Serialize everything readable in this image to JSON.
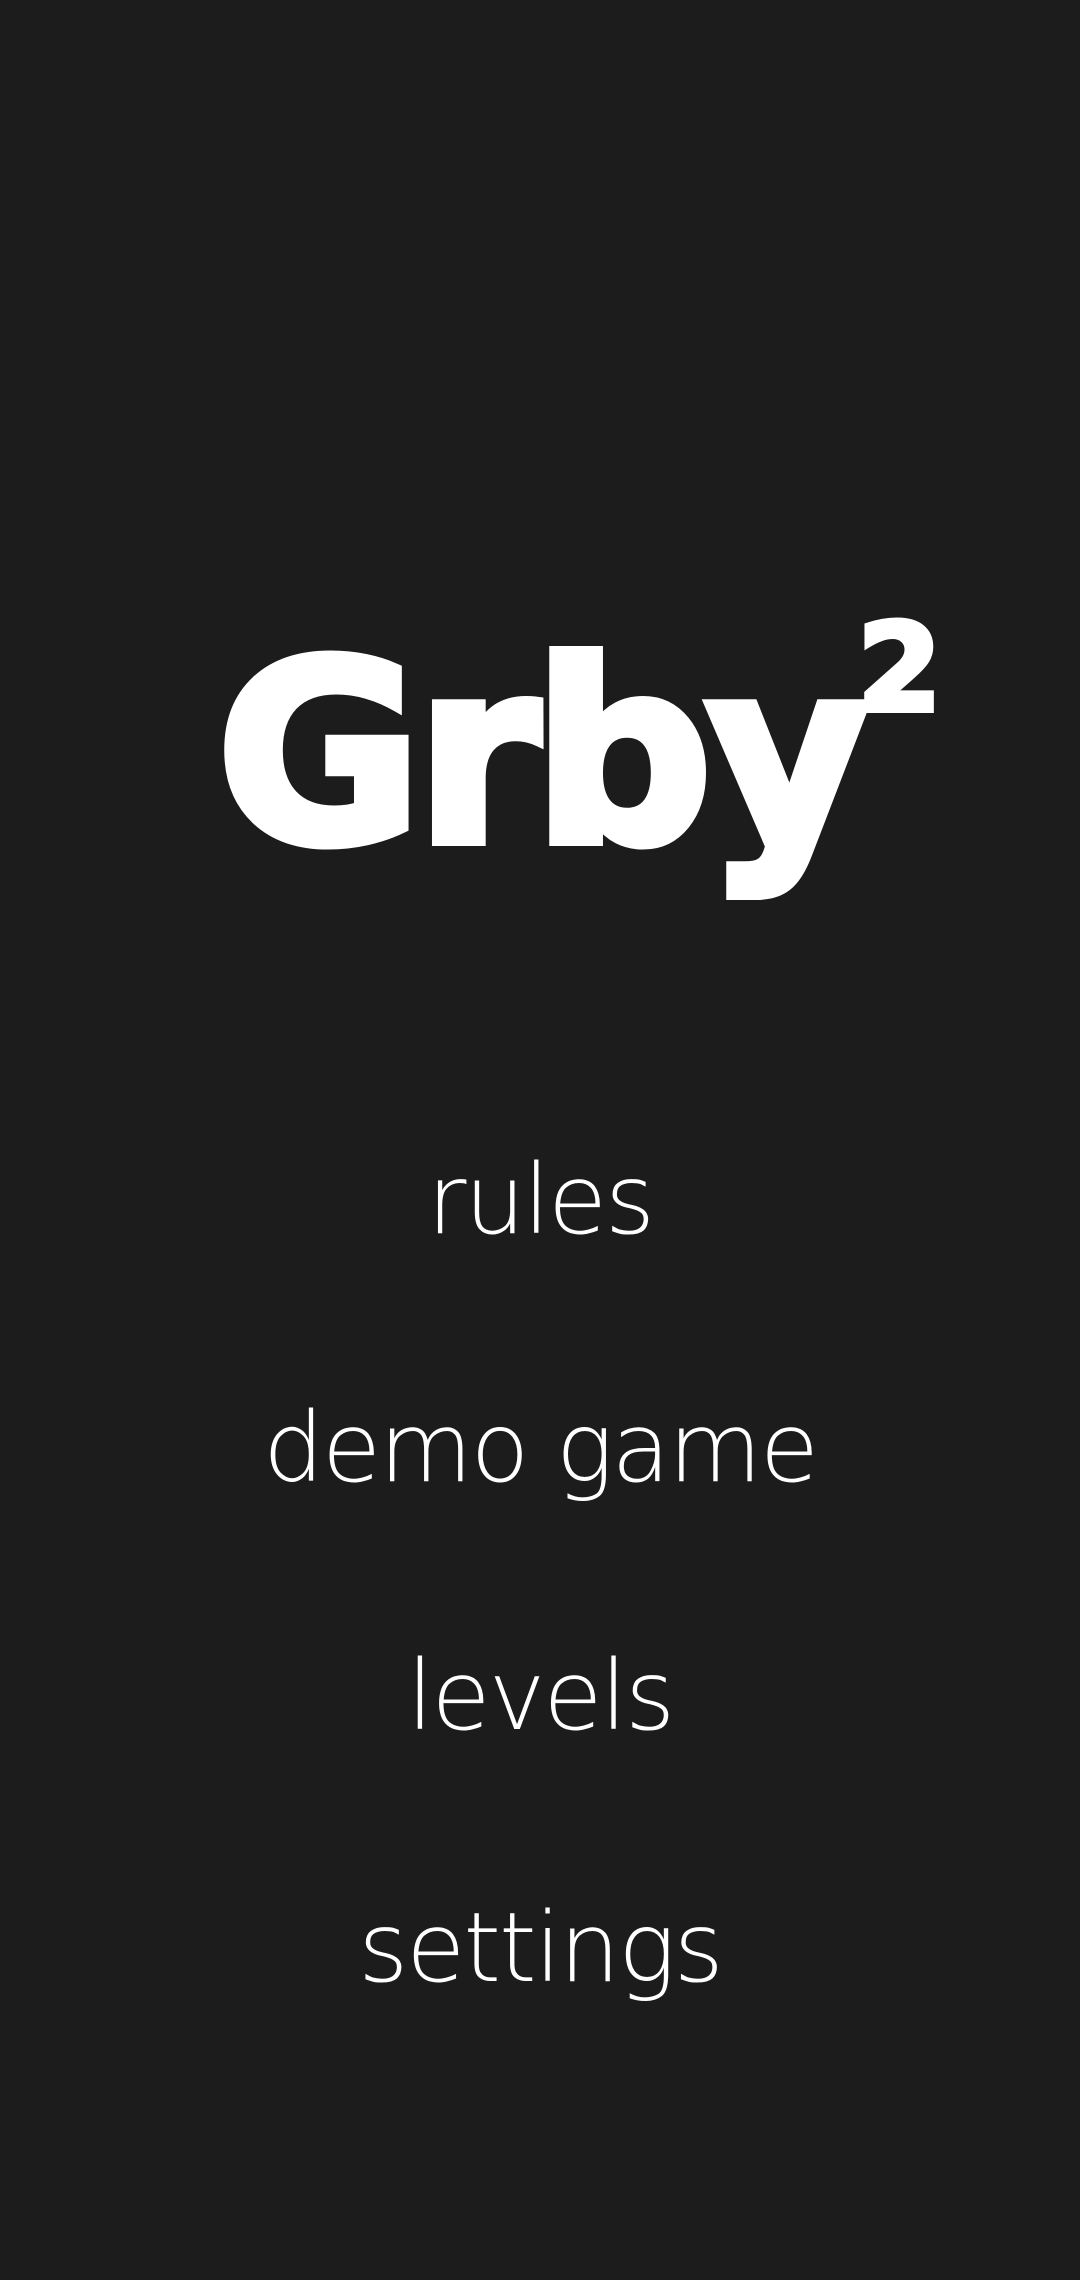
{
  "app": {
    "logo_text": "Grby",
    "logo_superscript": "2"
  },
  "menu": {
    "items": [
      {
        "label": "rules"
      },
      {
        "label": "demo game"
      },
      {
        "label": "levels"
      },
      {
        "label": "settings"
      }
    ]
  },
  "colors": {
    "background": "#1c1c1c",
    "foreground": "#ffffff"
  }
}
